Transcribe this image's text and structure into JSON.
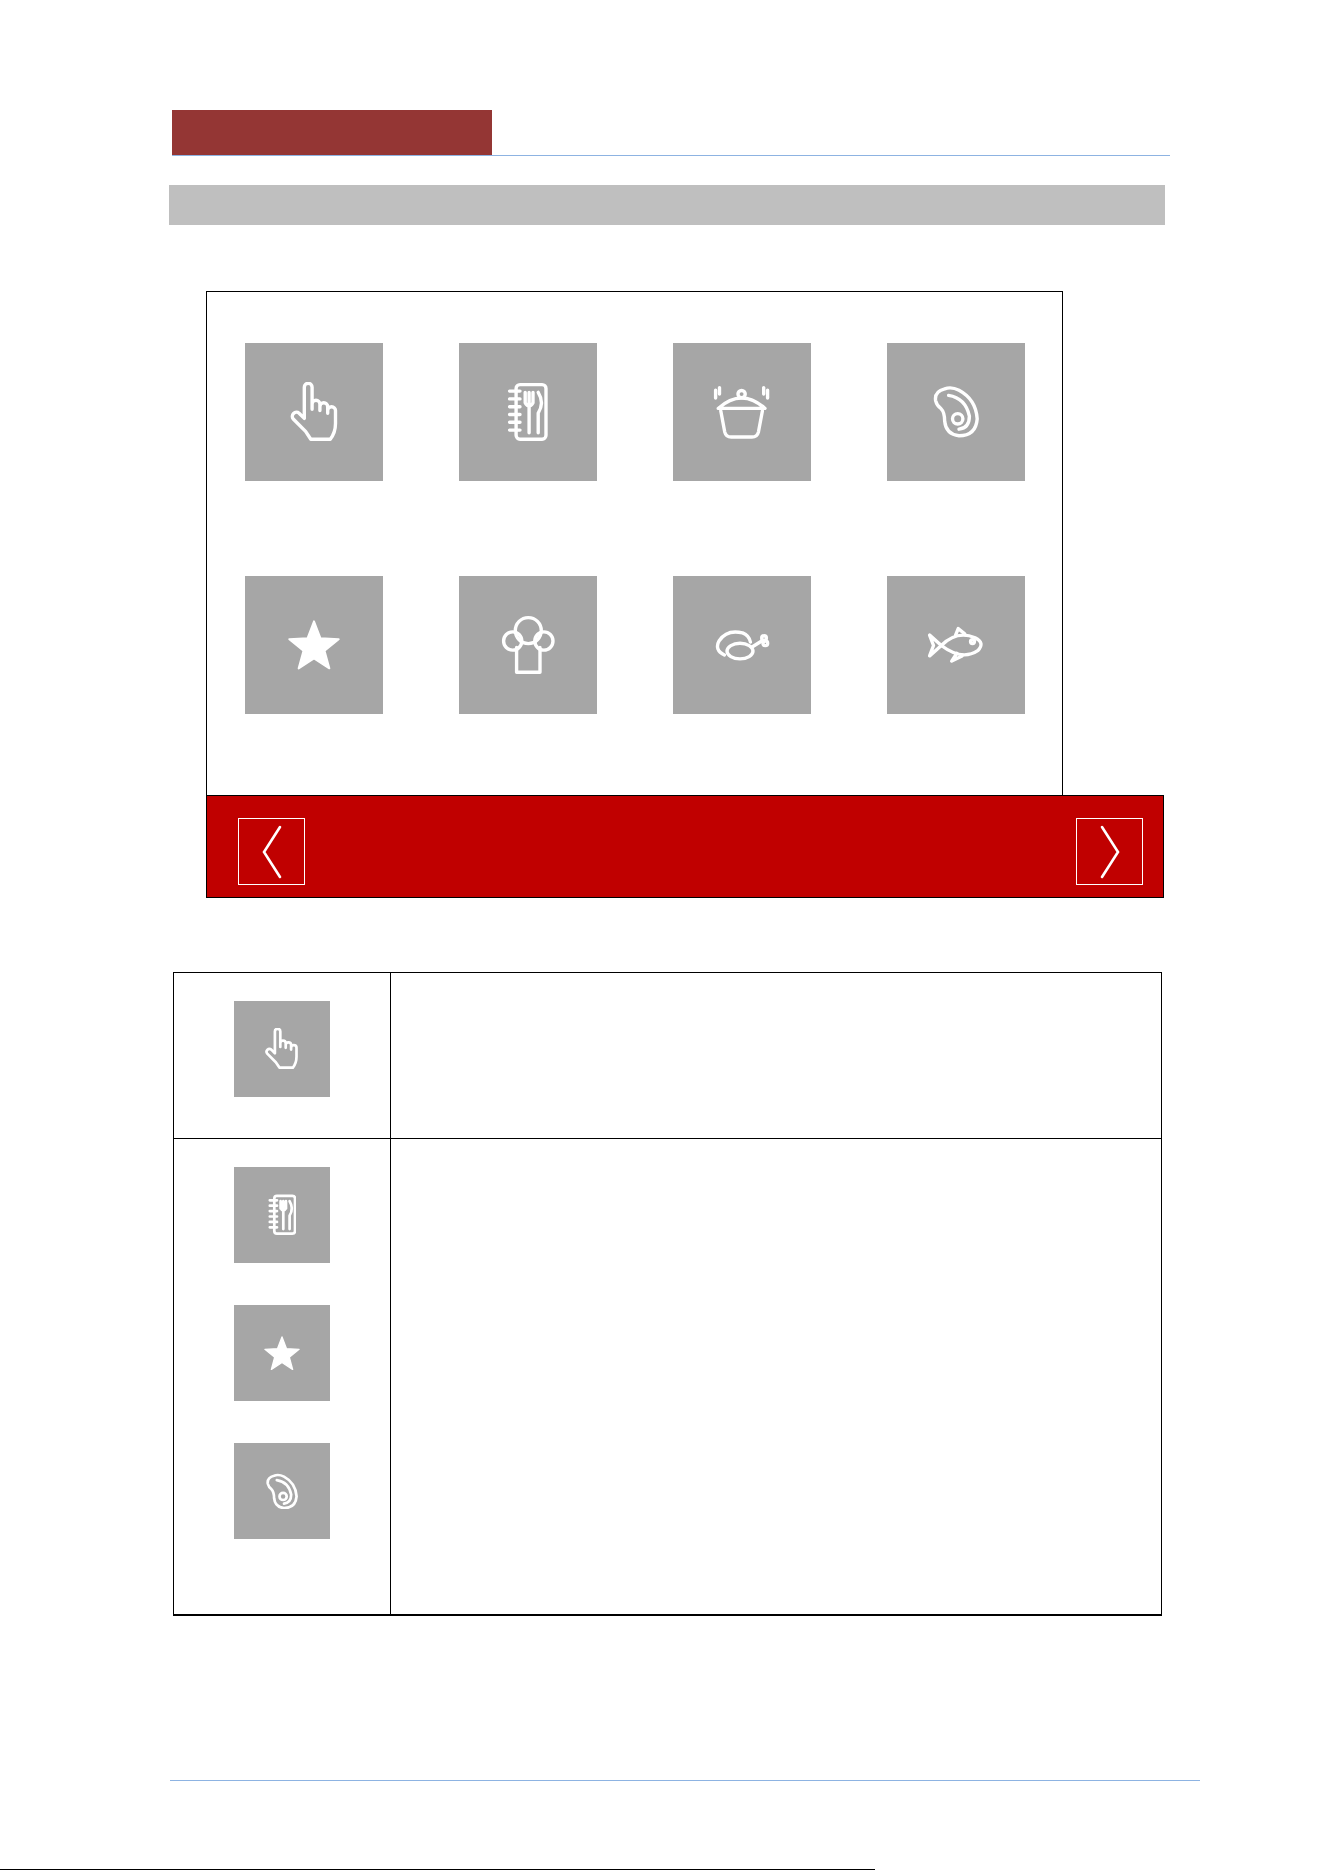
{
  "menu_grid": {
    "tiles": [
      {
        "kind": "hand"
      },
      {
        "kind": "menu"
      },
      {
        "kind": "pot"
      },
      {
        "kind": "steak"
      },
      {
        "kind": "star"
      },
      {
        "kind": "chef"
      },
      {
        "kind": "chicken"
      },
      {
        "kind": "fish"
      }
    ]
  },
  "nav_bar": {
    "buttons": [
      {
        "kind": "previous"
      },
      {
        "kind": "next"
      }
    ]
  },
  "legend_table": {
    "rows": [
      {
        "icons": [
          {
            "kind": "hand"
          }
        ]
      },
      {
        "icons": [
          {
            "kind": "menu"
          },
          {
            "kind": "star"
          },
          {
            "kind": "steak"
          }
        ]
      }
    ]
  }
}
